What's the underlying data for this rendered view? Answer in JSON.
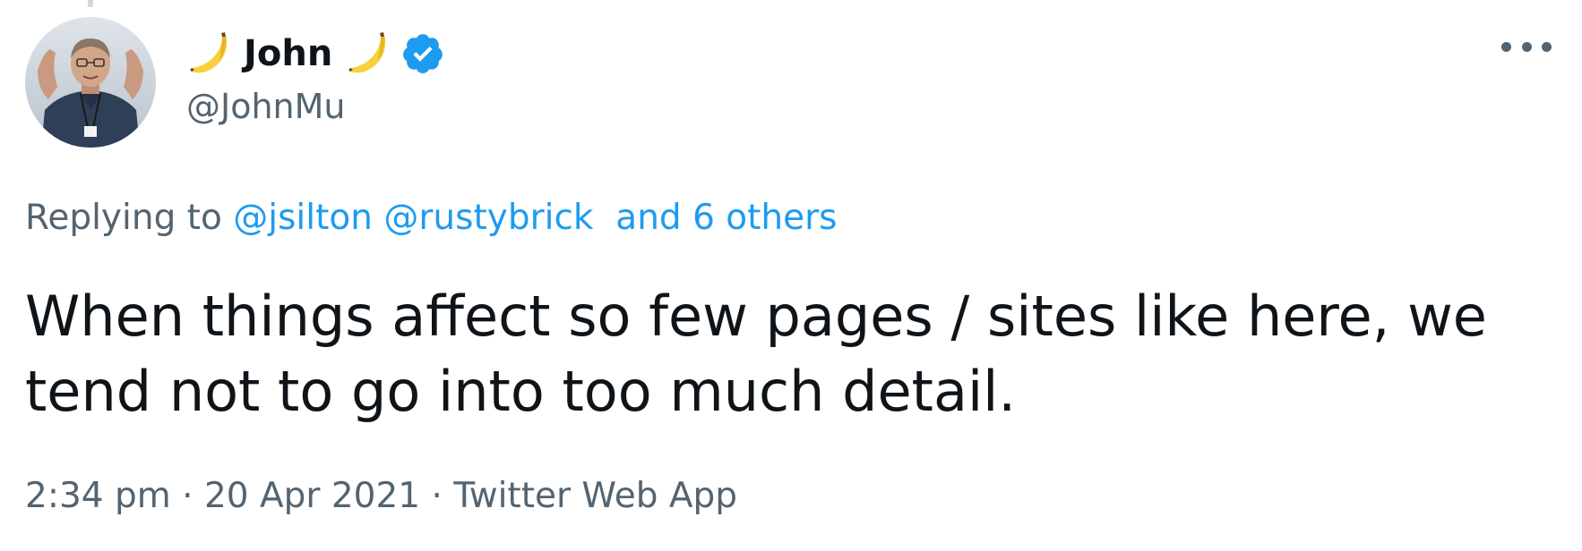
{
  "author": {
    "display_name": "John",
    "name_emoji": "banana-icon",
    "verified": true,
    "handle": "@JohnMu",
    "avatar": "profile-photo"
  },
  "reply_context": {
    "prefix": "Replying to",
    "mentions": [
      "@jsilton",
      "@rustybrick"
    ],
    "others": "and 6 others"
  },
  "tweet": {
    "text": "When things affect so few pages / sites like here, we tend not to go into too much detail."
  },
  "meta": {
    "time": "2:34 pm",
    "separator": "·",
    "date": "20 Apr 2021",
    "source": "Twitter Web App"
  },
  "colors": {
    "link": "#1d9bf0",
    "secondary_text": "#536471",
    "primary_text": "#0f1419",
    "verified_badge": "#1d9bf0"
  }
}
